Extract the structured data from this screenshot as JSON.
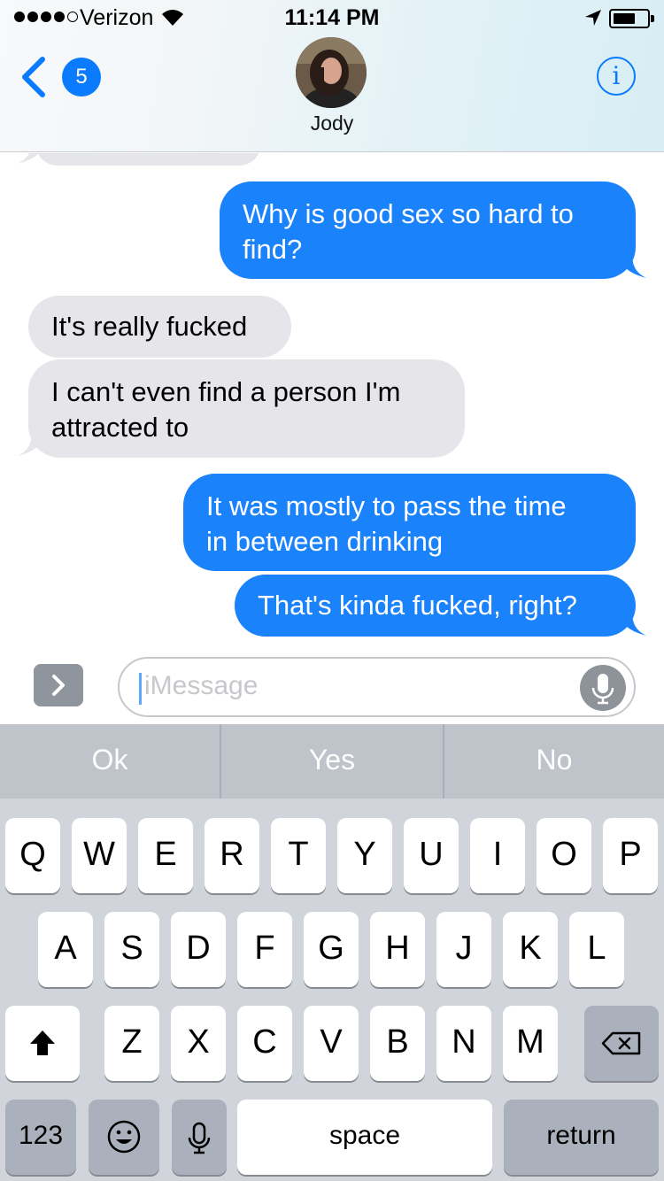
{
  "status_bar": {
    "carrier": "Verizon",
    "time": "11:14 PM"
  },
  "header": {
    "back_count": "5",
    "contact_name": "Jody",
    "info_label": "i"
  },
  "messages": [
    {
      "direction": "outgoing",
      "text_lines": [
        "Why is good sex so hard to",
        "find?"
      ]
    },
    {
      "direction": "incoming",
      "text_lines": [
        "It's really fucked"
      ]
    },
    {
      "direction": "incoming",
      "text_lines": [
        "I can't even find a person I'm",
        "attracted to"
      ]
    },
    {
      "direction": "outgoing",
      "text_lines": [
        "It was mostly to pass the time",
        "in between drinking"
      ]
    },
    {
      "direction": "outgoing",
      "text_lines": [
        "That's kinda fucked, right?"
      ]
    }
  ],
  "input": {
    "placeholder": "iMessage"
  },
  "keyboard": {
    "predictions": [
      "Ok",
      "Yes",
      "No"
    ],
    "row1": [
      "Q",
      "W",
      "E",
      "R",
      "T",
      "Y",
      "U",
      "I",
      "O",
      "P"
    ],
    "row2": [
      "A",
      "S",
      "D",
      "F",
      "G",
      "H",
      "J",
      "K",
      "L"
    ],
    "row3": [
      "Z",
      "X",
      "C",
      "V",
      "B",
      "N",
      "M"
    ],
    "numbers_label": "123",
    "space_label": "space",
    "return_label": "return"
  },
  "colors": {
    "accent": "#0a7bfd",
    "outgoing_bubble": "#1a82fb",
    "incoming_bubble": "#e5e5ea",
    "keyboard_bg": "#d1d5db"
  }
}
